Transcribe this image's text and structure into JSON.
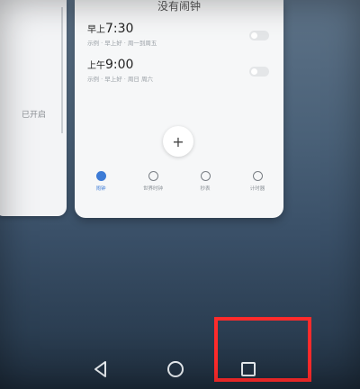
{
  "left_card": {
    "status": "已开启"
  },
  "clock_card": {
    "title": "没有闹钟",
    "alarms": [
      {
        "ampm": "早上",
        "time": "7:30",
        "desc": "示例  ·  早上好  ·  周一到周五"
      },
      {
        "ampm": "上午",
        "time": "9:00",
        "desc": "示例  ·  早上好  ·  周日  周六"
      }
    ],
    "add_label": "+",
    "nav": [
      {
        "label": "闹钟",
        "active": true
      },
      {
        "label": "世界时钟",
        "active": false
      },
      {
        "label": "秒表",
        "active": false
      },
      {
        "label": "计时器",
        "active": false
      }
    ]
  },
  "colors": {
    "accent": "#3d7bd6",
    "highlight": "#ff2b2b"
  },
  "system_nav": {
    "back_icon": "back-triangle-icon",
    "home_icon": "home-circle-icon",
    "recent_icon": "recent-square-icon"
  }
}
